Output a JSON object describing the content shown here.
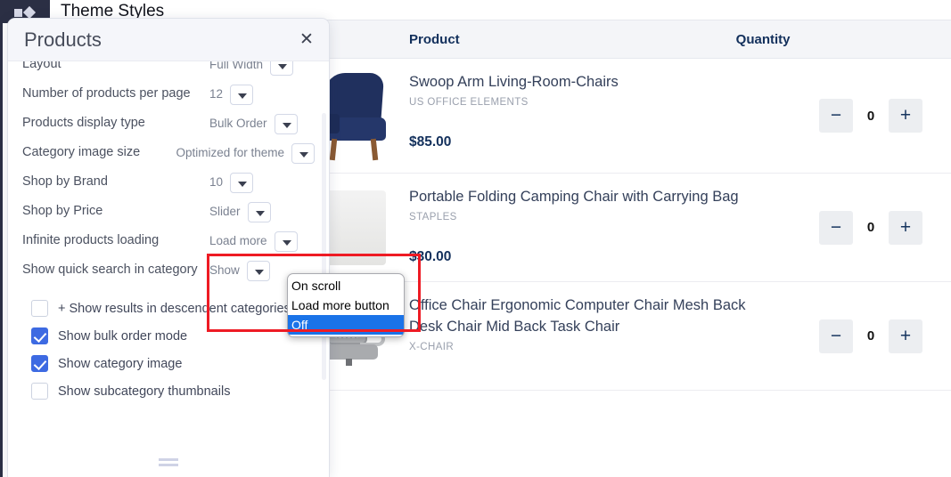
{
  "app": {
    "logo_icon": "square-diamond-logo-icon",
    "header_title": "Theme Styles"
  },
  "dialog": {
    "title": "Products",
    "close_icon": "close-icon",
    "resize_handle_icon": "resize-handle-icon",
    "settings": [
      {
        "label": "Layout",
        "value": "Full Width",
        "control": "select",
        "clipped": true
      },
      {
        "label": "Number of products per page",
        "value": "12",
        "control": "select"
      },
      {
        "label": "Products display type",
        "value": "Bulk Order",
        "control": "select"
      },
      {
        "label": "Category image size",
        "value": "Optimized for theme",
        "control": "select"
      },
      {
        "label": "Shop by Brand",
        "value": "10",
        "control": "select"
      },
      {
        "label": "Shop by Price",
        "value": "Slider",
        "control": "select"
      },
      {
        "label": "Infinite products loading",
        "value": "Load more",
        "control": "select",
        "highlighted": true
      },
      {
        "label": "Show quick search in category",
        "value": "Show",
        "control": "select"
      }
    ],
    "checkboxes": [
      {
        "label": "+ Show results in descendent categories",
        "checked": false
      },
      {
        "label": "Show bulk order mode",
        "checked": true
      },
      {
        "label": "Show category image",
        "checked": true
      },
      {
        "label": "Show subcategory thumbnails",
        "checked": false
      }
    ]
  },
  "dropdown_popup": {
    "options": [
      "On scroll",
      "Load more button",
      "Off"
    ],
    "selected": "Off"
  },
  "product_table": {
    "columns": [
      "Product",
      "Quantity"
    ],
    "rows": [
      {
        "title": "Swoop Arm Living-Room-Chairs",
        "brand": "US OFFICE ELEMENTS",
        "price": "$85.00",
        "quantity": "0",
        "thumb_icon": "navy-armchair-image",
        "minus_label": "−",
        "plus_label": "+"
      },
      {
        "title": "Portable Folding Camping Chair with Carrying Bag",
        "brand": "STAPLES",
        "price": "$30.00",
        "quantity": "0",
        "thumb_icon": "folding-chair-image",
        "minus_label": "−",
        "plus_label": "+"
      },
      {
        "title": "Office Chair Ergonomic Computer Chair Mesh Back Desk Chair Mid Back Task Chair",
        "brand": "X-CHAIR",
        "price": "",
        "quantity": "0",
        "thumb_icon": "mesh-office-chair-image",
        "minus_label": "−",
        "plus_label": "+"
      }
    ]
  },
  "annotation": {
    "highlight_color": "#ee1b24"
  },
  "colors": {
    "accent_blue": "#3d6ae2",
    "select_highlight": "#1a73e8",
    "navy_text": "#13305c",
    "dark_nav": "#2b2f44"
  }
}
